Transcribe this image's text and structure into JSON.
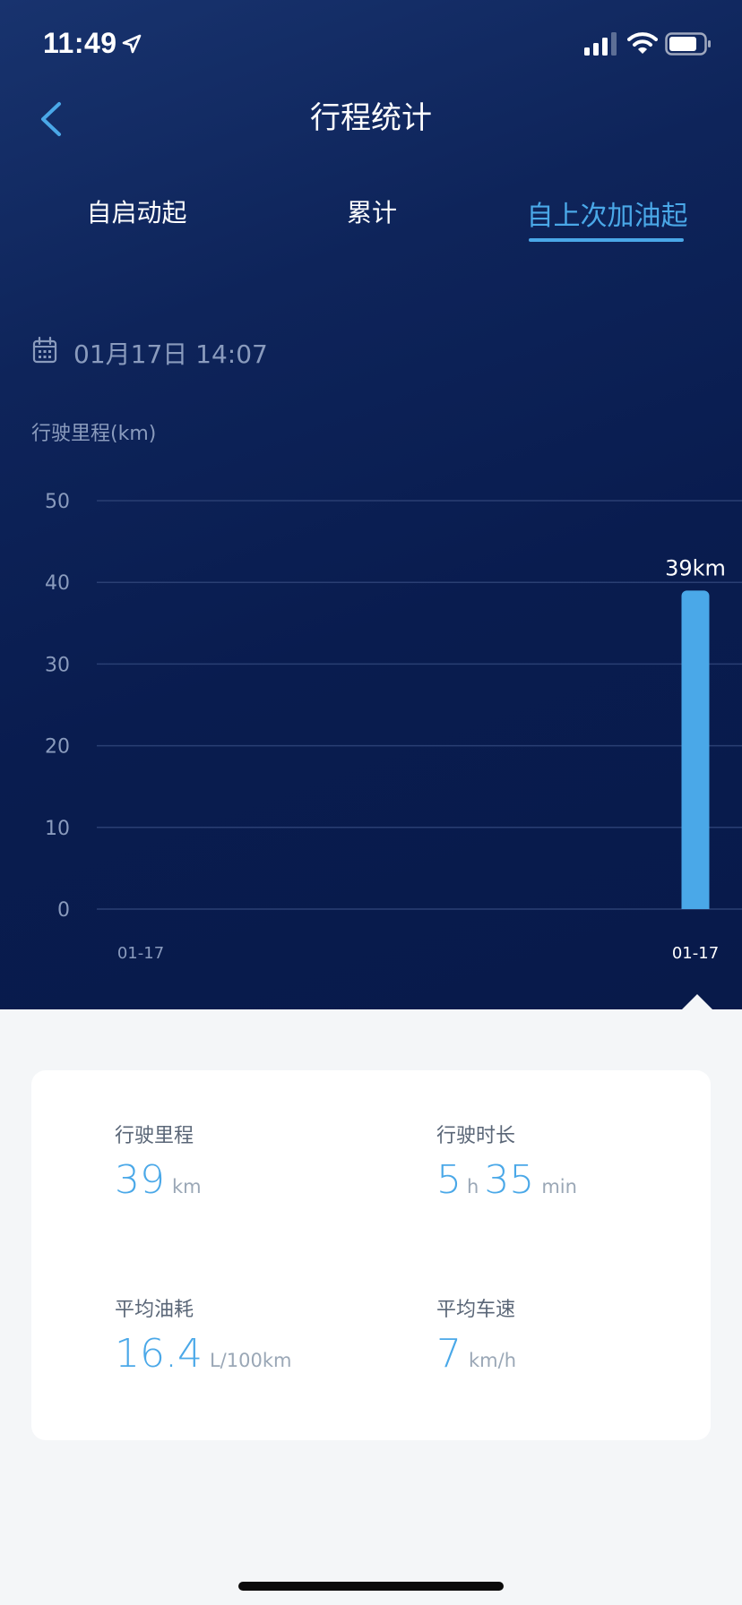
{
  "status_bar": {
    "time": "11:49"
  },
  "nav": {
    "title": "行程统计"
  },
  "tabs": [
    {
      "label": "自启动起",
      "active": false
    },
    {
      "label": "累计",
      "active": false
    },
    {
      "label": "自上次加油起",
      "active": true
    }
  ],
  "date": "01月17日 14:07",
  "chart_title": "行驶里程(km)",
  "chart_data": {
    "type": "bar",
    "ylabel": "行驶里程(km)",
    "ylim": [
      0,
      50
    ],
    "yticks": [
      0,
      10,
      20,
      30,
      40,
      50
    ],
    "x_tick_labels": [
      "01-17",
      "01-17"
    ],
    "categories": [
      "01-17"
    ],
    "values": [
      39
    ],
    "value_labels": [
      "39km"
    ],
    "grid": true,
    "bar_color": "#4aa8e8"
  },
  "stats": {
    "distance": {
      "label": "行驶里程",
      "value": "39",
      "unit": "km"
    },
    "duration": {
      "label": "行驶时长",
      "hours": "5",
      "hours_unit": "h",
      "minutes": "35",
      "minutes_unit": "min"
    },
    "fuel": {
      "label": "平均油耗",
      "value": "16.4",
      "unit": "L/100km"
    },
    "speed": {
      "label": "平均车速",
      "value": "7",
      "unit": "km/h"
    }
  },
  "colors": {
    "accent": "#4aa8e8",
    "hero_bg": "#0b1f55",
    "page_bg": "#f4f6f8"
  }
}
